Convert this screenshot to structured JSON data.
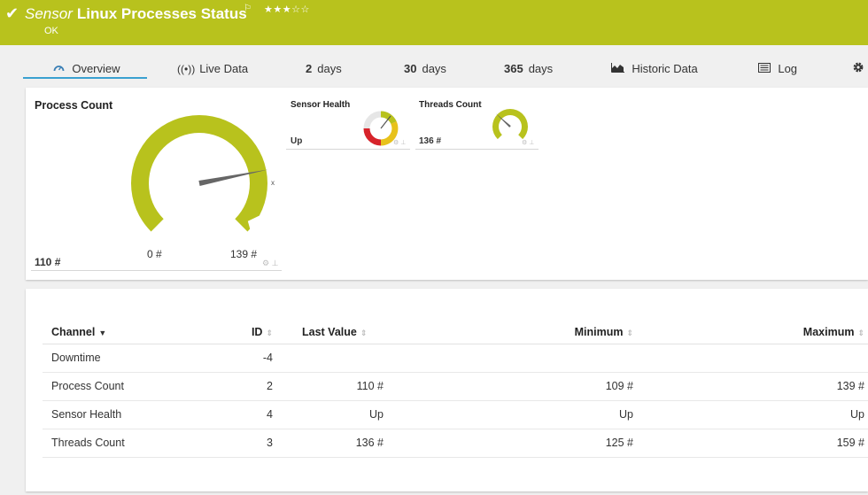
{
  "header": {
    "check_icon": "✔",
    "type_label": "Sensor",
    "title": "Linux Processes Status",
    "flag_icon": "⚐",
    "stars": "★★★☆☆",
    "status": "OK",
    "bg_color": "#b8c21d"
  },
  "tabs": [
    {
      "icon": "gauge-icon",
      "label": "Overview"
    },
    {
      "icon": "live-icon",
      "label": "Live Data"
    },
    {
      "num": "2",
      "label": "days"
    },
    {
      "num": "30",
      "label": "days"
    },
    {
      "num": "365",
      "label": "days"
    },
    {
      "icon": "area-chart-icon",
      "label": "Historic Data"
    },
    {
      "icon": "log-icon",
      "label": "Log"
    }
  ],
  "gauges": {
    "process": {
      "title": "Process Count",
      "value": "110 #",
      "min_label": "0 #",
      "max_label": "139 #",
      "min": 0,
      "max": 139,
      "current": 110,
      "marker": "x",
      "color": "#b8c21d"
    },
    "health": {
      "title": "Sensor Health",
      "value": "Up"
    },
    "threads": {
      "title": "Threads Count",
      "value": "136 #",
      "min": 125,
      "max": 159,
      "current": 136
    }
  },
  "table": {
    "headers": {
      "channel": "Channel",
      "id": "ID",
      "last": "Last Value",
      "min": "Minimum",
      "max": "Maximum"
    },
    "rows": [
      {
        "channel": "Downtime",
        "id": "-4",
        "last": "",
        "min": "",
        "max": ""
      },
      {
        "channel": "Process Count",
        "id": "2",
        "last": "110 #",
        "min": "109 #",
        "max": "139 #"
      },
      {
        "channel": "Sensor Health",
        "id": "4",
        "last": "Up",
        "min": "Up",
        "max": "Up"
      },
      {
        "channel": "Threads Count",
        "id": "3",
        "last": "136 #",
        "min": "125 #",
        "max": "159 #"
      }
    ]
  }
}
